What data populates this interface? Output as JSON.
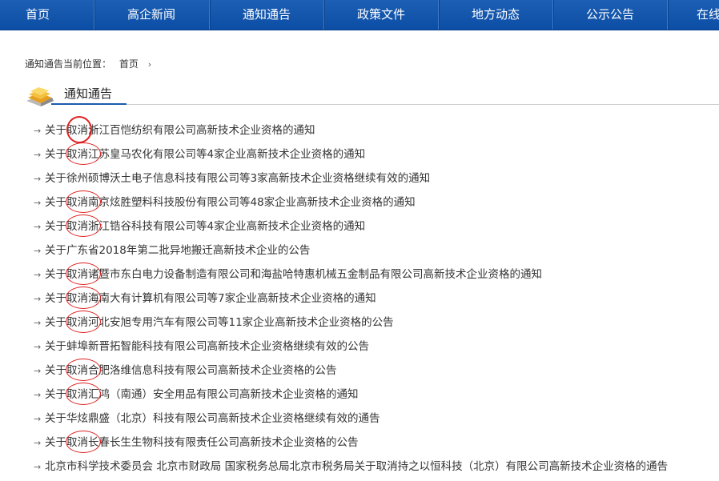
{
  "nav": {
    "items": [
      "首页",
      "高企新闻",
      "通知通告",
      "政策文件",
      "地方动态",
      "公示公告",
      "在线"
    ]
  },
  "breadcrumb": {
    "label": "通知通告当前位置：",
    "home": "首页",
    "arrow": "›"
  },
  "section": {
    "title": "通知通告"
  },
  "news": [
    "关于取消浙江百恺纺织有限公司高新技术企业资格的通知",
    "关于取消江苏皇马农化有限公司等4家企业高新技术企业资格的通知",
    "关于徐州硕博沃土电子信息科技有限公司等3家高新技术企业资格继续有效的通知",
    "关于取消南京炫胜塑料科技股份有限公司等48家企业高新技术企业资格的通知",
    "关于取消浙江锆谷科技有限公司等4家企业高新技术企业资格的通知",
    "关于广东省2018年第二批异地搬迁高新技术企业的公告",
    "关于取消诸暨市东白电力设备制造有限公司和海盐哈特惠机械五金制品有限公司高新技术企业资格的通知",
    "关于取消海南大有计算机有限公司等7家企业高新技术企业资格的通知",
    "关于取消河北安旭专用汽车有限公司等11家企业高新技术企业资格的公告",
    "关于蚌埠新晋拓智能科技有限公司高新技术企业资格继续有效的公告",
    "关于取消合肥洛维信息科技有限公司高新技术企业资格的公告",
    "关于取消汇鸿（南通）安全用品有限公司高新技术企业资格的通知",
    "关于华炫鼎盛（北京）科技有限公司高新技术企业资格继续有效的通告",
    "关于取消长春长生生物科技有限责任公司高新技术企业资格的公告",
    "北京市科学技术委员会 北京市财政局 国家税务总局北京市税务局关于取消持之以恒科技（北京）有限公司高新技术企业资格的通告"
  ],
  "bullet": "→",
  "annotated_rows": [
    0,
    1,
    3,
    4,
    6,
    7,
    8,
    10,
    11,
    13
  ],
  "colors": {
    "nav_bg": "#0c4ea5",
    "annotation": "#e02020",
    "rule_accent": "#1a5cad"
  }
}
